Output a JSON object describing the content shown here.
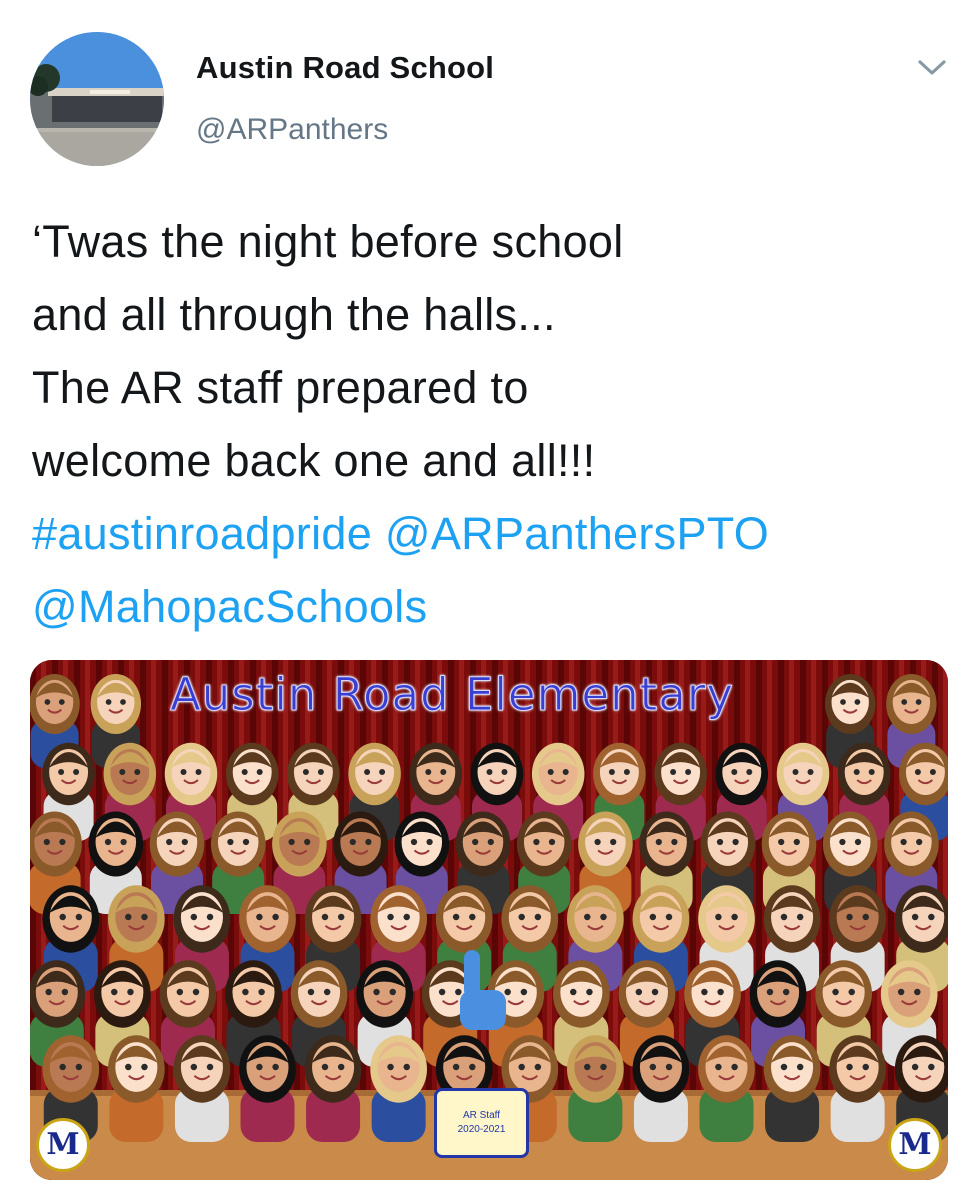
{
  "tweet": {
    "author": {
      "display_name": "Austin Road School",
      "handle": "@ARPanthers"
    },
    "text_lines": [
      "‘Twas the night before school",
      "and all through the halls...",
      "The AR staff prepared to",
      "welcome back one and all!!!"
    ],
    "hashtag": "#austinroadpride",
    "mention_1": "@ARPanthersPTO",
    "mention_2": "@MahopacSchools",
    "menu_icon": "chevron-down-icon",
    "link_color": "#1da1f2"
  },
  "media": {
    "banner_text": "Austin Road Elementary",
    "plaque_line_1": "AR Staff",
    "plaque_line_2": "2020-2021",
    "logo_letter": "M",
    "colors": {
      "curtain": "#7a0c0c",
      "stage": "#c98a4a",
      "title": "#3a3fd1"
    }
  }
}
